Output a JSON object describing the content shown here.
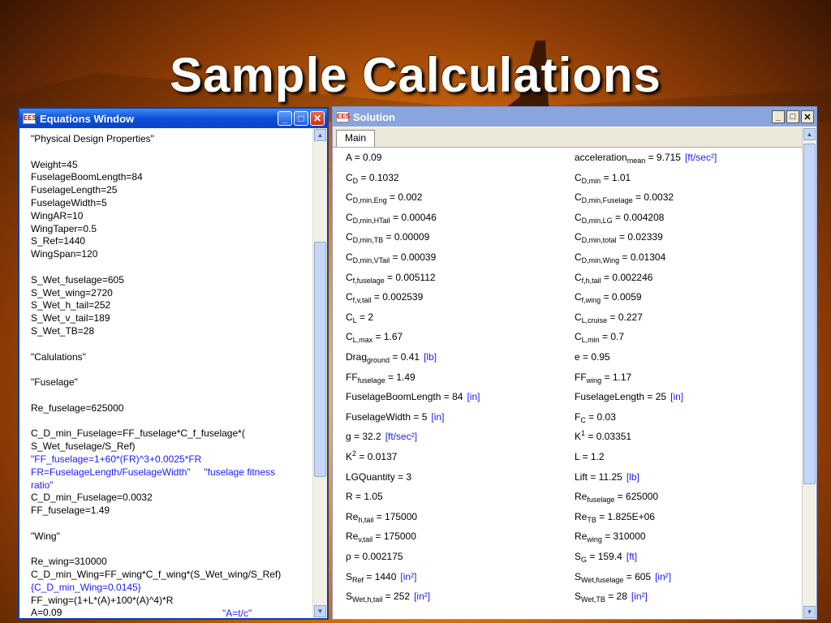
{
  "slide": {
    "title": "Sample Calculations"
  },
  "equations_window": {
    "title": "Equations Window",
    "lines": [
      {
        "text": "\"Physical Design Properties\"",
        "blue": false
      },
      {
        "text": "",
        "blue": false
      },
      {
        "text": "Weight=45",
        "blue": false
      },
      {
        "text": "FuselageBoomLength=84",
        "blue": false
      },
      {
        "text": "FuselageLength=25",
        "blue": false
      },
      {
        "text": "FuselageWidth=5",
        "blue": false
      },
      {
        "text": "WingAR=10",
        "blue": false
      },
      {
        "text": "WingTaper=0.5",
        "blue": false
      },
      {
        "text": "S_Ref=1440",
        "blue": false
      },
      {
        "text": "WingSpan=120",
        "blue": false
      },
      {
        "text": "",
        "blue": false
      },
      {
        "text": "S_Wet_fuselage=605",
        "blue": false
      },
      {
        "text": "S_Wet_wing=2720",
        "blue": false
      },
      {
        "text": "S_Wet_h_tail=252",
        "blue": false
      },
      {
        "text": "S_Wet_v_tail=189",
        "blue": false
      },
      {
        "text": "S_Wet_TB=28",
        "blue": false
      },
      {
        "text": "",
        "blue": false
      },
      {
        "text": "\"Calulations\"",
        "blue": false
      },
      {
        "text": "",
        "blue": false
      },
      {
        "text": "\"Fuselage\"",
        "blue": false
      },
      {
        "text": "",
        "blue": false
      },
      {
        "text": "Re_fuselage=625000",
        "blue": false
      },
      {
        "text": "",
        "blue": false
      },
      {
        "text": "C_D_min_Fuselage=FF_fuselage*C_f_fuselage*(",
        "blue": false
      },
      {
        "text": "S_Wet_fuselage/S_Ref)",
        "blue": false
      },
      {
        "text": "\"FF_fuselage=1+60*(FR)^3+0.0025*FR",
        "blue": true
      },
      {
        "text": "FR=FuselageLength/FuselageWidth\"     \"fuselage fitness",
        "blue": true
      },
      {
        "text": "ratio\"",
        "blue": true
      },
      {
        "text": "C_D_min_Fuselage=0.0032",
        "blue": false
      },
      {
        "text": "FF_fuselage=1.49",
        "blue": false
      },
      {
        "text": "",
        "blue": false
      },
      {
        "text": "\"Wing\"",
        "blue": false
      },
      {
        "text": "",
        "blue": false
      },
      {
        "text": "Re_wing=310000",
        "blue": false
      },
      {
        "text": "C_D_min_Wing=FF_wing*C_f_wing*(S_Wet_wing/S_Ref)",
        "blue": false
      },
      {
        "text": "{C_D_min_Wing=0.0145}",
        "blue": true
      },
      {
        "text": "FF_wing=(1+L*(A)+100*(A)^4)*R",
        "blue": false
      },
      {
        "text": "A=0.09",
        "blue": false
      }
    ],
    "last_line_comment": "\"A=t/c\""
  },
  "solution_window": {
    "title": "Solution",
    "tab": "Main",
    "left_column": [
      {
        "name": "A ",
        "sub": "",
        "sup": "",
        "value": " = 0.09",
        "unit": ""
      },
      {
        "name": "C",
        "sub": "D",
        "sup": "",
        "value": "  = 0.1032",
        "unit": ""
      },
      {
        "name": "C",
        "sub": "D,min,Eng",
        "sup": "",
        "value": "  = 0.002",
        "unit": ""
      },
      {
        "name": "C",
        "sub": "D,min,HTail",
        "sup": "",
        "value": " = 0.00046",
        "unit": ""
      },
      {
        "name": "C",
        "sub": "D,min,TB",
        "sup": "",
        "value": "  = 0.00009",
        "unit": ""
      },
      {
        "name": "C",
        "sub": "D,min,VTail",
        "sup": "",
        "value": " = 0.00039",
        "unit": ""
      },
      {
        "name": "C",
        "sub": "f,fuselage",
        "sup": "",
        "value": "  = 0.005112",
        "unit": ""
      },
      {
        "name": "C",
        "sub": "f,v,tail",
        "sup": "",
        "value": "  = 0.002539",
        "unit": ""
      },
      {
        "name": "C",
        "sub": "L",
        "sup": "",
        "value": " = 2",
        "unit": ""
      },
      {
        "name": "C",
        "sub": "L,max",
        "sup": "",
        "value": "  = 1.67",
        "unit": ""
      },
      {
        "name": "Drag",
        "sub": "ground",
        "sup": "",
        "value": " = 0.41",
        "unit": "[lb]"
      },
      {
        "name": "FF",
        "sub": "fuselage",
        "sup": "",
        "value": " = 1.49",
        "unit": ""
      },
      {
        "name": "FuselageBoomLength",
        "sub": "",
        "sup": "",
        "value": " = 84",
        "unit": "[in]"
      },
      {
        "name": "FuselageWidth",
        "sub": "",
        "sup": "",
        "value": " = 5",
        "unit": "[in]"
      },
      {
        "name": "g",
        "sub": "",
        "sup": "",
        "value": " = 32.2",
        "unit": "[ft/sec²]"
      },
      {
        "name": "K",
        "sub": "",
        "sup": "2",
        "value": " = 0.0137",
        "unit": ""
      },
      {
        "name": "LGQuantity",
        "sub": "",
        "sup": "",
        "value": " = 3",
        "unit": ""
      },
      {
        "name": "R ",
        "sub": "",
        "sup": "",
        "value": " = 1.05",
        "unit": ""
      },
      {
        "name": "Re",
        "sub": "h,tail",
        "sup": "",
        "value": " = 175000",
        "unit": ""
      },
      {
        "name": "Re",
        "sub": "v,tail",
        "sup": "",
        "value": " = 175000",
        "unit": ""
      },
      {
        "name": "ρ",
        "sub": "",
        "sup": "",
        "value": " = 0.002175",
        "unit": ""
      },
      {
        "name": "S",
        "sub": "Ref",
        "sup": "",
        "value": " = 1440",
        "unit": "[in²]"
      },
      {
        "name": "S",
        "sub": "Wet,h,tail",
        "sup": "",
        "value": " = 252",
        "unit": "[in²]"
      }
    ],
    "right_column": [
      {
        "name": "acceleration",
        "sub": "mean",
        "sup": "",
        "value": "  = 9.715",
        "unit": "[ft/sec²]"
      },
      {
        "name": "C",
        "sub": "D,min",
        "sup": "",
        "value": " = 1.01",
        "unit": ""
      },
      {
        "name": "C",
        "sub": "D,min,Fuselage",
        "sup": "",
        "value": " = 0.0032",
        "unit": ""
      },
      {
        "name": "C",
        "sub": "D,min,LG",
        "sup": "",
        "value": " = 0.004208",
        "unit": ""
      },
      {
        "name": "C",
        "sub": "D,min,total",
        "sup": "",
        "value": "  = 0.02339",
        "unit": ""
      },
      {
        "name": "C",
        "sub": "D,min,Wing",
        "sup": "",
        "value": " = 0.01304",
        "unit": ""
      },
      {
        "name": "C",
        "sub": "f,h,tail",
        "sup": "",
        "value": " = 0.002246",
        "unit": ""
      },
      {
        "name": "C",
        "sub": "f,wing",
        "sup": "",
        "value": "  = 0.0059",
        "unit": ""
      },
      {
        "name": "C",
        "sub": "L,cruise",
        "sup": "",
        "value": "  = 0.227",
        "unit": ""
      },
      {
        "name": "C",
        "sub": "L,min",
        "sup": "",
        "value": " = 0.7",
        "unit": ""
      },
      {
        "name": "e",
        "sub": "",
        "sup": "",
        "value": " = 0.95",
        "unit": ""
      },
      {
        "name": "FF",
        "sub": "wing",
        "sup": "",
        "value": " = 1.17",
        "unit": ""
      },
      {
        "name": "FuselageLength",
        "sub": "",
        "sup": "",
        "value": " = 25",
        "unit": "[in]"
      },
      {
        "name": "F",
        "sub": "C",
        "sup": "",
        "value": " = 0.03",
        "unit": ""
      },
      {
        "name": "K",
        "sub": "",
        "sup": "1",
        "value": " = 0.03351",
        "unit": ""
      },
      {
        "name": "L",
        "sub": "",
        "sup": "",
        "value": " = 1.2",
        "unit": ""
      },
      {
        "name": "Lift ",
        "sub": "",
        "sup": "",
        "value": " = 11.25",
        "unit": "[lb]"
      },
      {
        "name": "Re",
        "sub": "fuselage",
        "sup": "",
        "value": "  = 625000",
        "unit": ""
      },
      {
        "name": "Re",
        "sub": "TB",
        "sup": "",
        "value": " = 1.825E+06",
        "unit": ""
      },
      {
        "name": "Re",
        "sub": "wing",
        "sup": "",
        "value": "  = 310000",
        "unit": ""
      },
      {
        "name": "S",
        "sub": "G",
        "sup": "",
        "value": "  = 159.4",
        "unit": "[ft]"
      },
      {
        "name": "S",
        "sub": "Wet,fuselage",
        "sup": "",
        "value": "  = 605",
        "unit": "[in²]"
      },
      {
        "name": "S",
        "sub": "Wet,TB",
        "sup": "",
        "value": " = 28",
        "unit": "[in²]"
      }
    ]
  }
}
